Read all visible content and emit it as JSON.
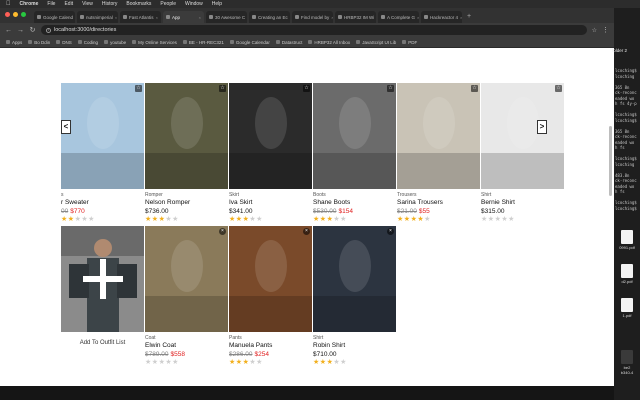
{
  "menubar": {
    "items": [
      "Chrome",
      "File",
      "Edit",
      "View",
      "History",
      "Bookmarks",
      "People",
      "Window",
      "Help"
    ]
  },
  "browser": {
    "tabs": [
      {
        "label": "Google Calend"
      },
      {
        "label": "nutsnimperial"
      },
      {
        "label": "Fast Atlantis"
      },
      {
        "label": "App"
      },
      {
        "label": "30 Awesome C"
      },
      {
        "label": "Creating an Ec"
      },
      {
        "label": "Find model by"
      },
      {
        "label": "HRBP32 IM Wi"
      },
      {
        "label": "A Complete G"
      },
      {
        "label": "Hackreactor 4"
      }
    ],
    "active_tab": 3,
    "url": "localhost:3000/directories",
    "bookmarks": [
      "Apps",
      "Bo Ddin",
      "DNS",
      "Coding",
      "youtube",
      "My Online Services",
      "BE - HR-REC321",
      "Google Calendar",
      "Datastruct",
      "HRBP32 All Inbox",
      "JavaScript UI Lib",
      "PDF"
    ]
  },
  "carousel": {
    "prev_label": "<",
    "next_label": ">",
    "row1": [
      {
        "category": "s",
        "name": "r Sweater",
        "old_price": "00",
        "price": "$770",
        "stars": 2,
        "photo": "#a8c6de"
      },
      {
        "category": "Romper",
        "name": "Nelson Romper",
        "old_price": "",
        "price": "$736.00",
        "stars": 3,
        "photo": "#5a5a40"
      },
      {
        "category": "Skirt",
        "name": "Iva Skirt",
        "old_price": "",
        "price": "$341.00",
        "stars": 3,
        "photo": "#2b2b2b"
      },
      {
        "category": "Boots",
        "name": "Shane Boots",
        "old_price": "$530.00",
        "price": "$154",
        "stars": 3,
        "photo": "#6b6b6b"
      },
      {
        "category": "Trousers",
        "name": "Sarina Trousers",
        "old_price": "$21.00",
        "price": "$55",
        "stars": 4,
        "photo": "#c9c3b6"
      },
      {
        "category": "Shirt",
        "name": "Bernie Shirt",
        "old_price": "",
        "price": "$315.00",
        "stars": 0,
        "photo": "#e8e8e8"
      }
    ],
    "row2": [
      {
        "category": "Coat",
        "name": "Elwin Coat",
        "old_price": "$789.00",
        "price": "$558",
        "stars": 0,
        "photo": "#8a7a5a"
      },
      {
        "category": "Pants",
        "name": "Manuela Pants",
        "old_price": "$286.00",
        "price": "$254",
        "stars": 3,
        "photo": "#7a4a2a"
      },
      {
        "category": "Shirt",
        "name": "Robin Shirt",
        "old_price": "",
        "price": "$710.00",
        "stars": 3,
        "photo": "#2c3440"
      }
    ],
    "add_outfit_label": "Add To Outfit List"
  },
  "desktop": {
    "folder_label": "folder 2",
    "terminal_lines": [
      "lcoching$",
      "lcoching",
      "",
      "365 8n",
      "ck-reconc",
      "eaded wo",
      "h fs 4y-p",
      "",
      "lcoching$",
      "lcoching$",
      "",
      "365 8n",
      "ck-reconc",
      "eaded wo",
      "h fs",
      "",
      "lcoching$",
      "lcoching",
      "",
      "483.8n",
      "ck-reconc",
      "eaded wo",
      "h fs",
      "",
      "lcoching$",
      "lcoching$"
    ],
    "files": [
      "0991.pdf",
      "d2.pdf",
      "1.pdf",
      "be2",
      "b340-4"
    ]
  },
  "colors": {
    "star_on": "#f2b01e",
    "star_off": "#cfcfcf",
    "sale_red": "#e02020"
  }
}
